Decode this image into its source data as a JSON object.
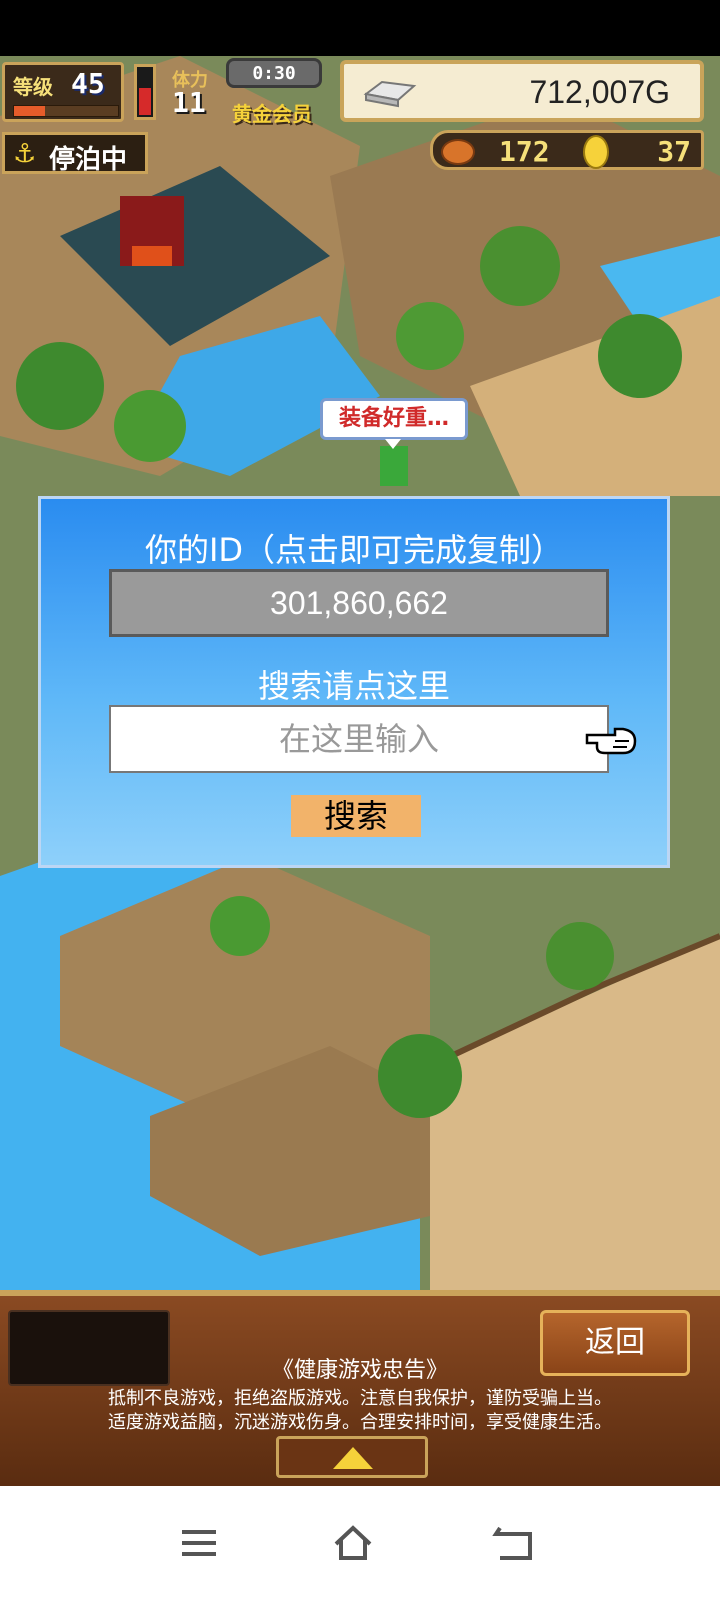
{
  "hud": {
    "level_label": "等级",
    "level_value": "45",
    "level_progress": 0.3,
    "stamina_label": "体力",
    "stamina_value": "11",
    "stamina_fill": 0.55,
    "timer": "0:30",
    "membership": "黄金会员",
    "money": "712,007G",
    "status": "停泊中",
    "food_count": "172",
    "medal_count": "37"
  },
  "speech_bubble": "装备好重…",
  "dialog": {
    "title": "你的ID（点击即可完成复制）",
    "user_id": "301,860,662",
    "search_caption": "搜索请点这里",
    "search_placeholder": "在这里输入",
    "search_button": "搜索"
  },
  "bottom": {
    "back_button": "返回",
    "health_title": "《健康游戏忠告》",
    "health_line1": "抵制不良游戏，拒绝盗版游戏。注意自我保护，谨防受骗上当。",
    "health_line2": "适度游戏益脑，沉迷游戏伤身。合理安排时间，享受健康生活。"
  },
  "colors": {
    "dialog_top": "#2a8cf0",
    "dialog_bottom": "#8ed0fa",
    "search_button": "#f2b36a",
    "money_panel": "#f5ecd2"
  },
  "icons": [
    "anchor-icon",
    "silver-bar-icon",
    "roast-meat-icon",
    "medal-icon",
    "pointing-hand-icon",
    "menu-icon",
    "home-icon",
    "back-icon"
  ]
}
